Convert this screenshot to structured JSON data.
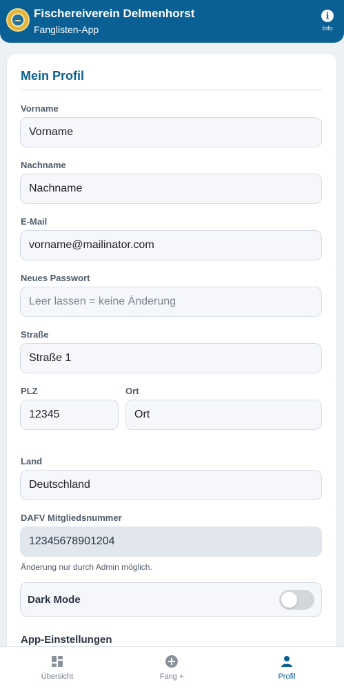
{
  "header": {
    "title": "Fischereiverein Delmenhorst",
    "subtitle": "Fanglisten-App",
    "info_label": "Info"
  },
  "profile": {
    "heading": "Mein Profil",
    "firstname": {
      "label": "Vorname",
      "value": "Vorname"
    },
    "lastname": {
      "label": "Nachname",
      "value": "Nachname"
    },
    "email": {
      "label": "E-Mail",
      "value": "vorname@mailinator.com"
    },
    "password": {
      "label": "Neues Passwort",
      "value": "",
      "placeholder": "Leer lassen = keine Änderung"
    },
    "street": {
      "label": "Straße",
      "value": "Straße 1"
    },
    "zip": {
      "label": "PLZ",
      "value": "12345"
    },
    "city": {
      "label": "Ort",
      "value": "Ort"
    },
    "country": {
      "label": "Land",
      "value": "Deutschland"
    },
    "member_number": {
      "label": "DAFV Mitgliedsnummer",
      "value": "12345678901204",
      "hint": "Änderung nur durch Admin möglich."
    },
    "dark_mode": {
      "label": "Dark Mode",
      "enabled": false
    },
    "app_settings_heading": "App-Einstellungen"
  },
  "nav": {
    "items": [
      {
        "label": "Übersicht",
        "icon": "dashboard-icon"
      },
      {
        "label": "Fang +",
        "icon": "add-circle-icon"
      },
      {
        "label": "Profil",
        "icon": "person-icon",
        "active": true
      }
    ]
  },
  "colors": {
    "primary": "#0a5f95",
    "background": "#eef1f4",
    "field_background": "#f5f7fb",
    "readonly_background": "#e2e7ee"
  }
}
